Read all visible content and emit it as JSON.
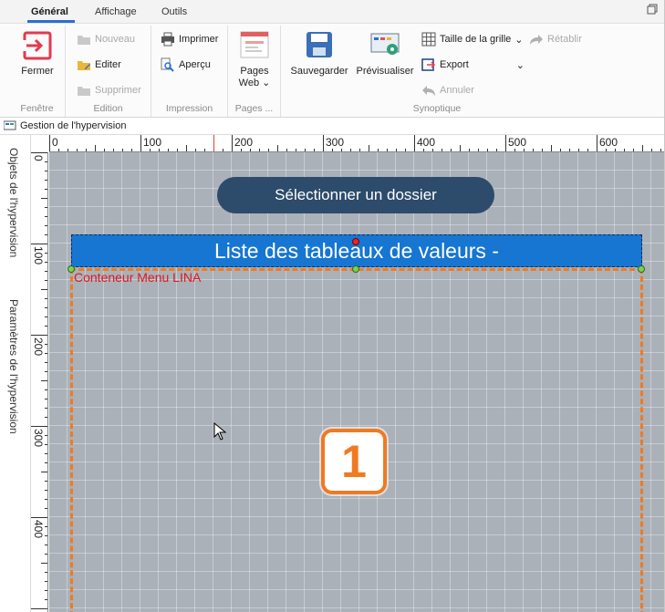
{
  "tabs": [
    {
      "label": "Général",
      "active": true
    },
    {
      "label": "Affichage",
      "active": false
    },
    {
      "label": "Outils",
      "active": false
    }
  ],
  "ribbon": {
    "fenetre": {
      "label": "Fenêtre",
      "close_label": "Fermer"
    },
    "edition": {
      "label": "Edition",
      "new_label": "Nouveau",
      "edit_label": "Editer",
      "delete_label": "Supprimer"
    },
    "impression": {
      "label": "Impression",
      "print_label": "Imprimer",
      "preview_label": "Aperçu"
    },
    "pages": {
      "label": "Pages ...",
      "web_line1": "Pages",
      "web_line2": "Web"
    },
    "synoptique": {
      "label": "Synoptique",
      "save_label": "Sauvegarder",
      "preview_label": "Prévisualiser",
      "grid_label": "Taille de la grille",
      "export_label": "Export",
      "redo_label": "Rétablir",
      "undo_label": "Annuler"
    }
  },
  "breadcrumb": {
    "title": "Gestion de l'hypervision"
  },
  "side_tabs": [
    "Objets de l'hypervision",
    "Paramètres de l'hypervision"
  ],
  "rulers": {
    "h_ticks": [
      "0",
      "100",
      "200",
      "300",
      "400",
      "500",
      "600"
    ],
    "v_ticks": [
      "0",
      "100",
      "200",
      "300",
      "400"
    ]
  },
  "canvas": {
    "folder_button": "Sélectionner un dossier",
    "list_title": "Liste des tableaux de valeurs -",
    "container_label": "Conteneur Menu LINA",
    "badge_number": "1"
  },
  "colors": {
    "accent": "#2a6fd6",
    "canvas_bg": "#aab1b9",
    "folder_button_bg": "#2d4b6b",
    "title_bg": "#1676d2",
    "container_border": "#f07a22",
    "container_label": "#e0171f"
  }
}
